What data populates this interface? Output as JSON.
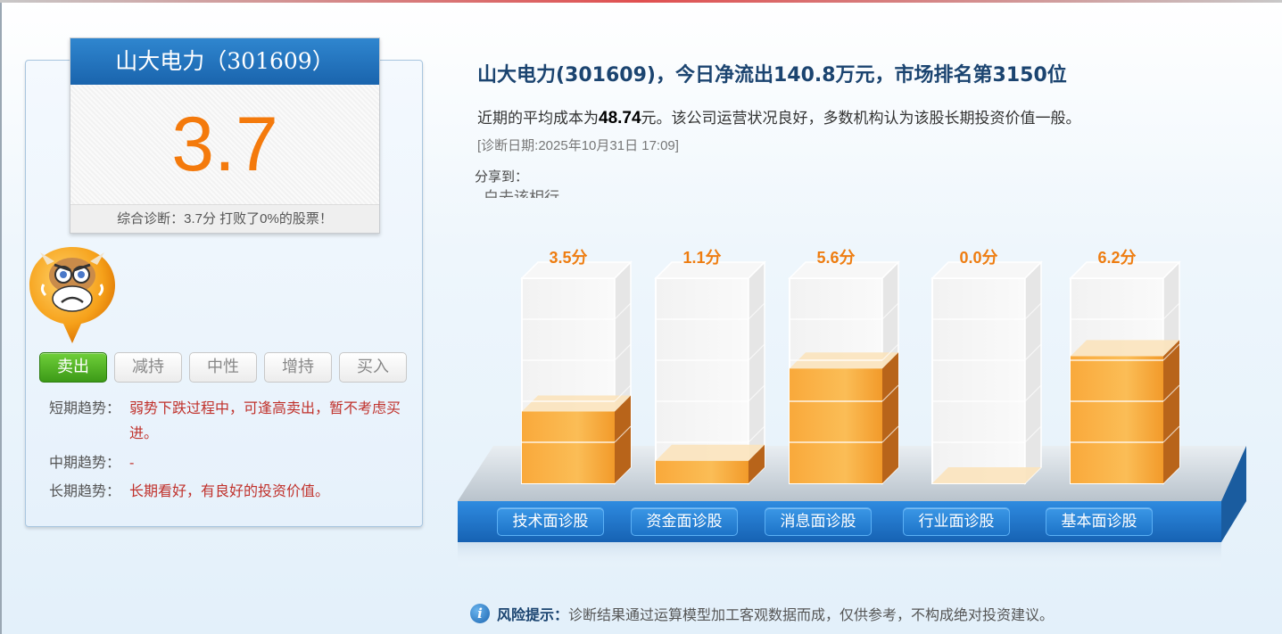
{
  "stock": {
    "title": "山大电力（301609）",
    "score": "3.7",
    "summary": "综合诊断：3.7分 打败了0%的股票！"
  },
  "ratings": {
    "options": [
      "卖出",
      "减持",
      "中性",
      "增持",
      "买入"
    ],
    "selected": "卖出"
  },
  "trends": {
    "short_label": "短期趋势：",
    "short_value": "弱势下跌过程中，可逢高卖出，暂不考虑买进。",
    "mid_label": "中期趋势：",
    "mid_value": "-",
    "long_label": "长期趋势：",
    "long_value": "长期看好，有良好的投资价值。"
  },
  "headline": "山大电力(301609)，今日净流出140.8万元，市场排名第3150位",
  "description": {
    "prefix": "近期的平均成本为",
    "cost": "48.74",
    "suffix": "元。该公司运营状况良好，多数机构认为该股长期投资价值一般。"
  },
  "diagnosis_date": "[诊断日期:2025年10月31日 17:09]",
  "share_label": "分享到：",
  "clipped_text": "白去该相行",
  "chart_data": {
    "type": "bar",
    "categories": [
      "技术面诊股",
      "资金面诊股",
      "消息面诊股",
      "行业面诊股",
      "基本面诊股"
    ],
    "values": [
      3.5,
      1.1,
      5.6,
      0.0,
      6.2
    ],
    "value_labels": [
      "3.5分",
      "1.1分",
      "5.6分",
      "0.0分",
      "6.2分"
    ],
    "ylim": [
      0,
      10
    ],
    "grid": true
  },
  "risk": {
    "label": "风险提示：",
    "text": "诊断结果通过运算模型加工客观数据而成，仅供参考，不构成绝对投资建议。"
  },
  "colors": {
    "accent_blue": "#1d73c7",
    "score_orange": "#f47a0c",
    "bar_orange": "#f7a233",
    "sell_green": "#4cae22",
    "trend_red": "#c0312b"
  },
  "icons": {
    "mascot": "angry-bull-icon",
    "info": "info-icon"
  }
}
